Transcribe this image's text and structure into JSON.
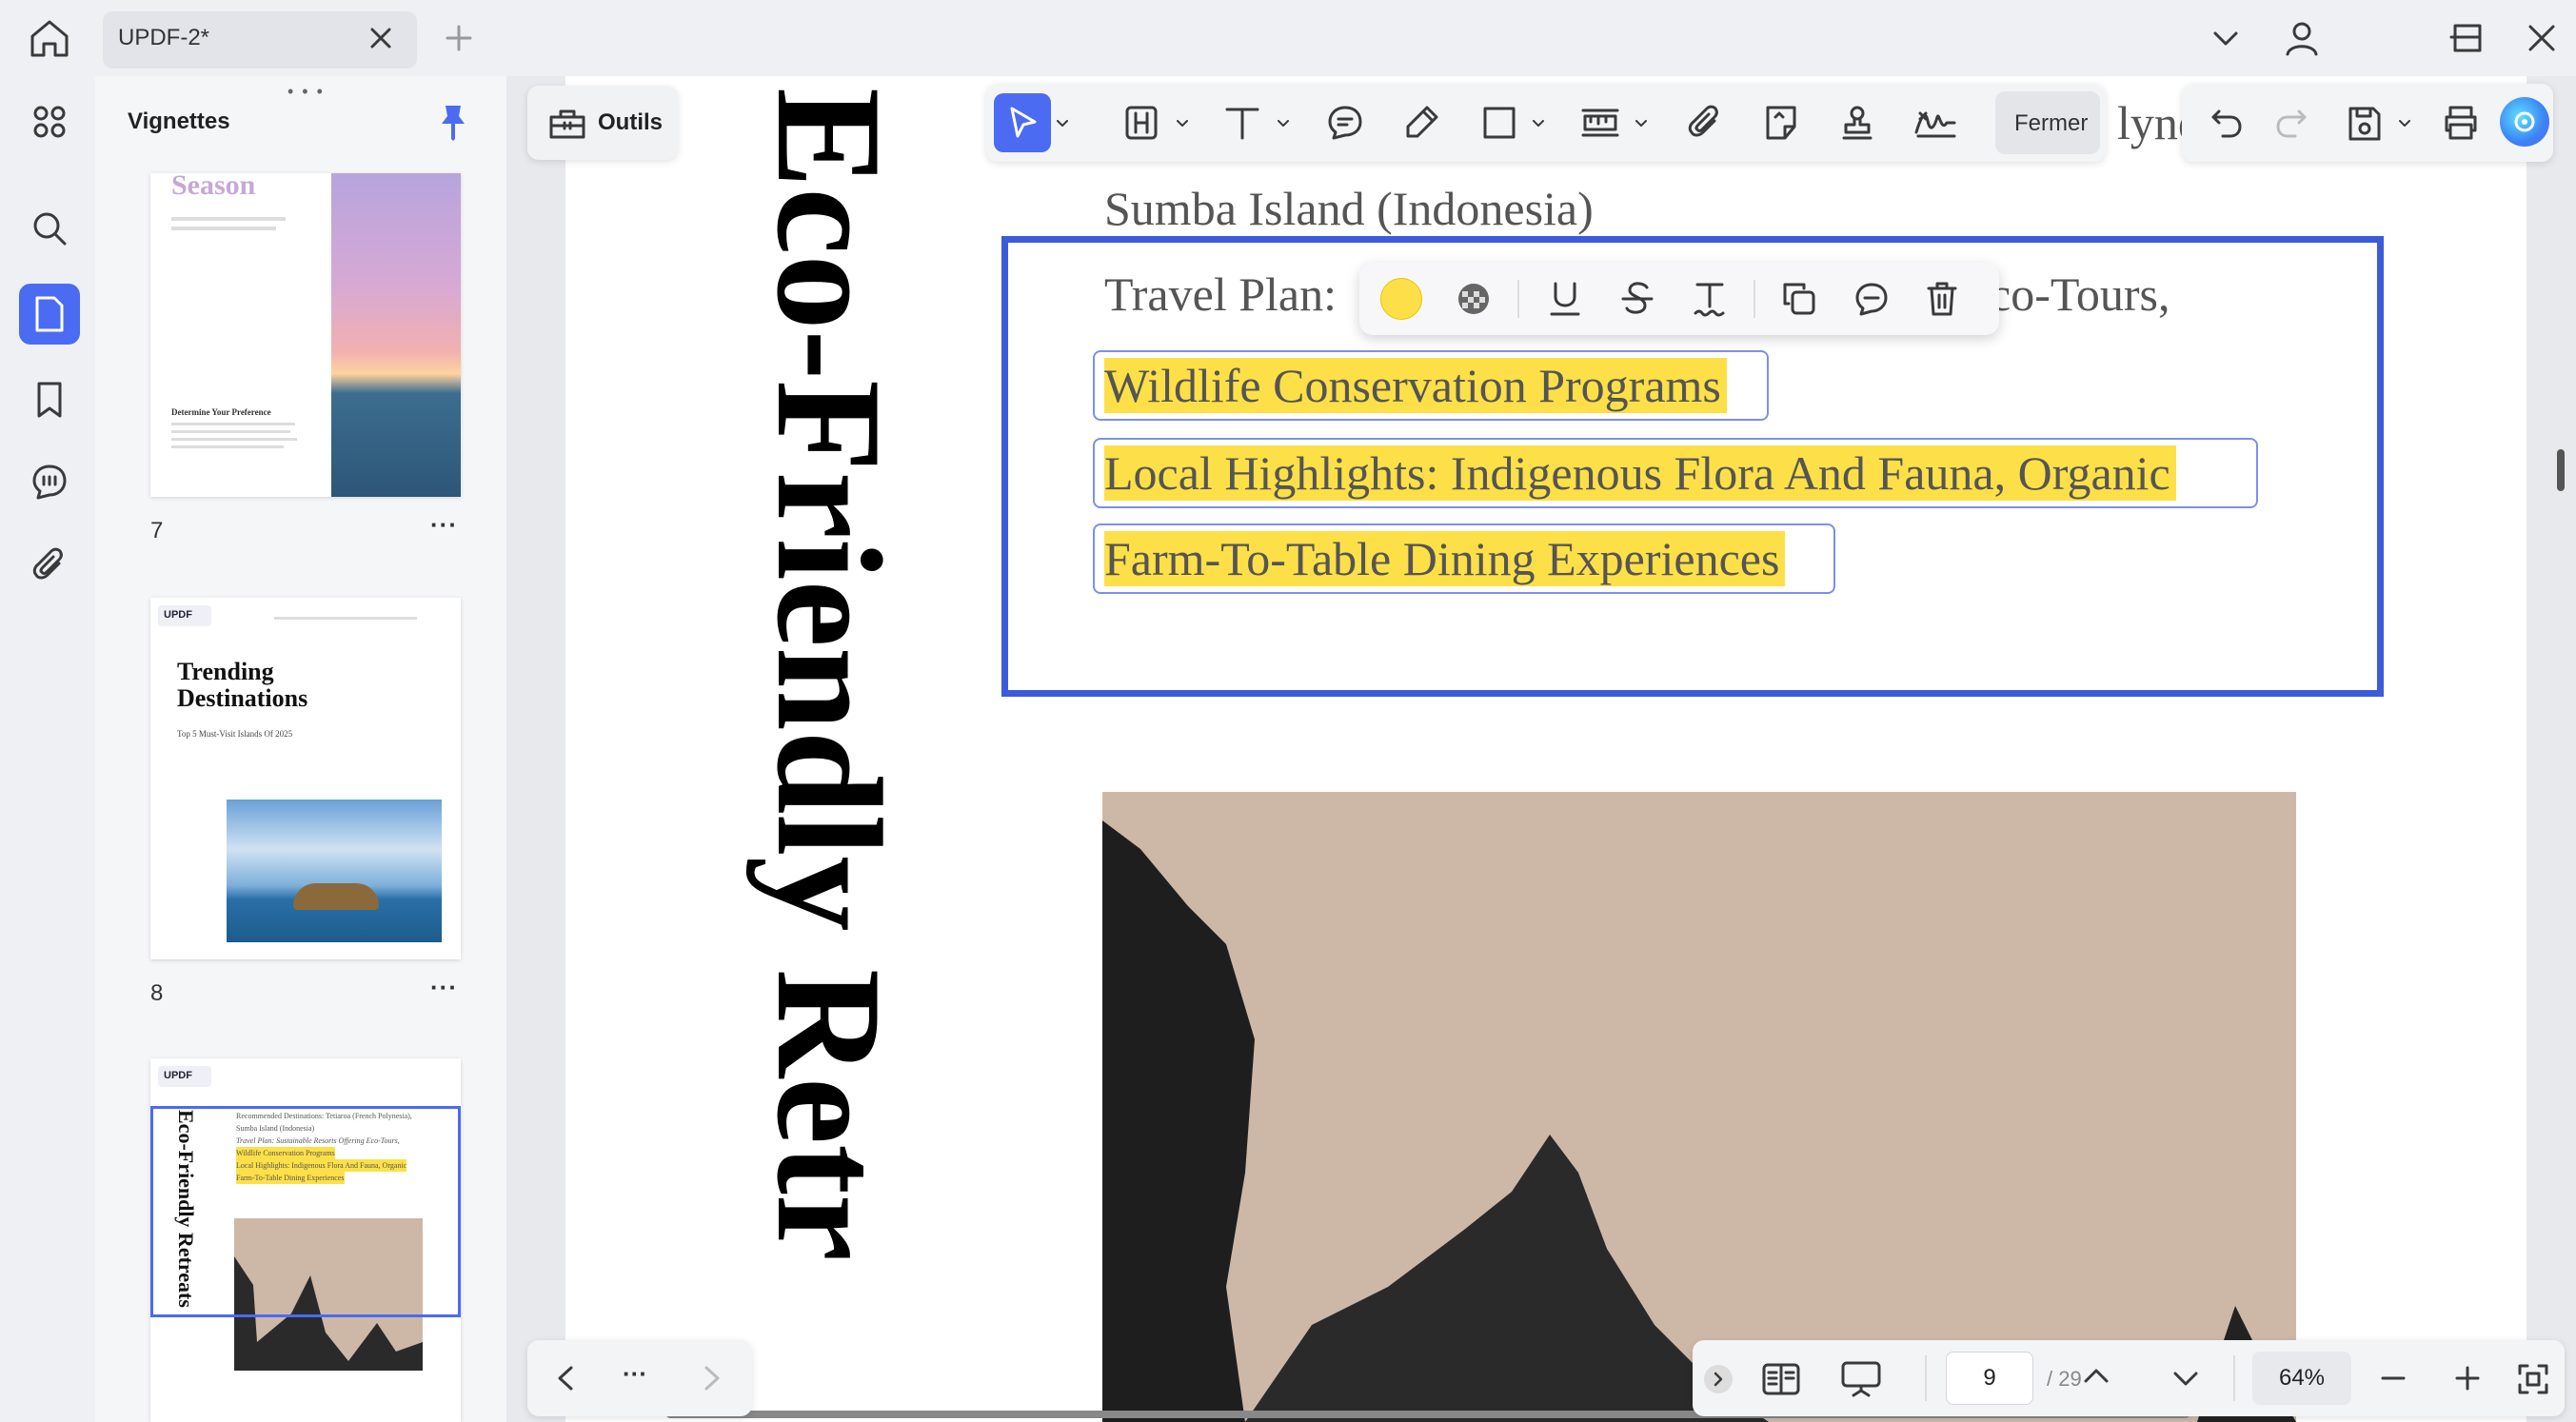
{
  "window": {
    "tab_title": "UPDF-2*",
    "colors": {
      "accent": "#4a6bf2",
      "highlight": "#fde047",
      "selection_border": "#3b5bdb"
    }
  },
  "sidebar": {
    "title": "Vignettes",
    "pin_icon": "pin-icon",
    "thumbnails": [
      {
        "page": "7",
        "heading": "Season",
        "subheading": "Determine Your Preference"
      },
      {
        "page": "8",
        "logo": "UPDF",
        "heading_line1": "Trending",
        "heading_line2": "Destinations",
        "subtitle": "Top 5 Must-Visit Islands Of 2025"
      },
      {
        "page": "9",
        "logo": "UPDF",
        "vertical_title": "Eco-Friendly Retreats",
        "lines": [
          "Recommended Destinations: Tetiaroa (French Polynesia),",
          "Sumba Island (Indonesia)",
          "Travel Plan: Sustainable Resorts Offering Eco-Tours,",
          "Wildlife Conservation Programs",
          "Local Highlights: Indigenous Flora And Fauna, Organic",
          "Farm-To-Table Dining Experiences"
        ]
      }
    ]
  },
  "toolbar": {
    "tools_label": "Outils",
    "close_label": "Fermer"
  },
  "document": {
    "vertical_title": "Eco-Friendly Retr",
    "partial_top_text": "lyne",
    "line1": "Sumba Island (Indonesia)",
    "line2_prefix": "Travel Plan:",
    "line2_suffix": "co-Tours,",
    "highlights": [
      "Wildlife Conservation Programs",
      "Local Highlights: Indigenous Flora And Fauna, Organic",
      "Farm-To-Table Dining Experiences"
    ]
  },
  "pager": {
    "current_page": "9",
    "total": "/ 29",
    "zoom": "64%"
  }
}
